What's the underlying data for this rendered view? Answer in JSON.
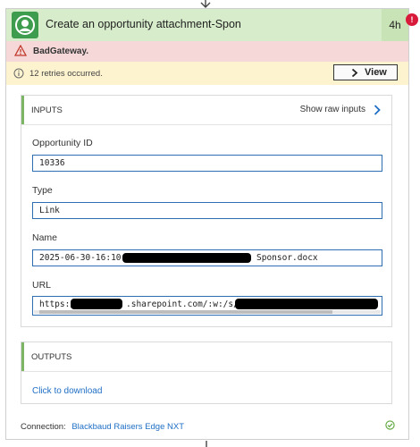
{
  "action": {
    "title": "Create an opportunity attachment-Spon",
    "duration": "4h",
    "badge_count": "!"
  },
  "error": {
    "text": "BadGateway."
  },
  "retries": {
    "text": "12 retries occurred.",
    "view_label": "View"
  },
  "inputs": {
    "header": "INPUTS",
    "show_raw": "Show raw inputs",
    "fields": [
      {
        "label": "Opportunity ID",
        "value": "10336"
      },
      {
        "label": "Type",
        "value": "Link"
      },
      {
        "label": "Name",
        "value_start": "2025-06-30-16:10-",
        "value_end": "Sponsor.docx"
      },
      {
        "label": "URL",
        "value_start": "https://",
        "value_mid": ".sharepoint.com/:w:/s/"
      }
    ]
  },
  "outputs": {
    "header": "OUTPUTS",
    "download_label": "Click to download"
  },
  "connection": {
    "label": "Connection:",
    "name": "Blackbaud Raisers Edge NXT"
  },
  "colors": {
    "success_header": "#d6ecca",
    "error_bg": "#f6d8d8",
    "warning_bg": "#fdf4cf",
    "link": "#1f6fc5",
    "badge": "#d81b3a"
  },
  "icons": [
    "chevron-down-icon",
    "user-icon",
    "warning-icon",
    "info-icon",
    "chevron-right-icon",
    "success-check-icon"
  ]
}
